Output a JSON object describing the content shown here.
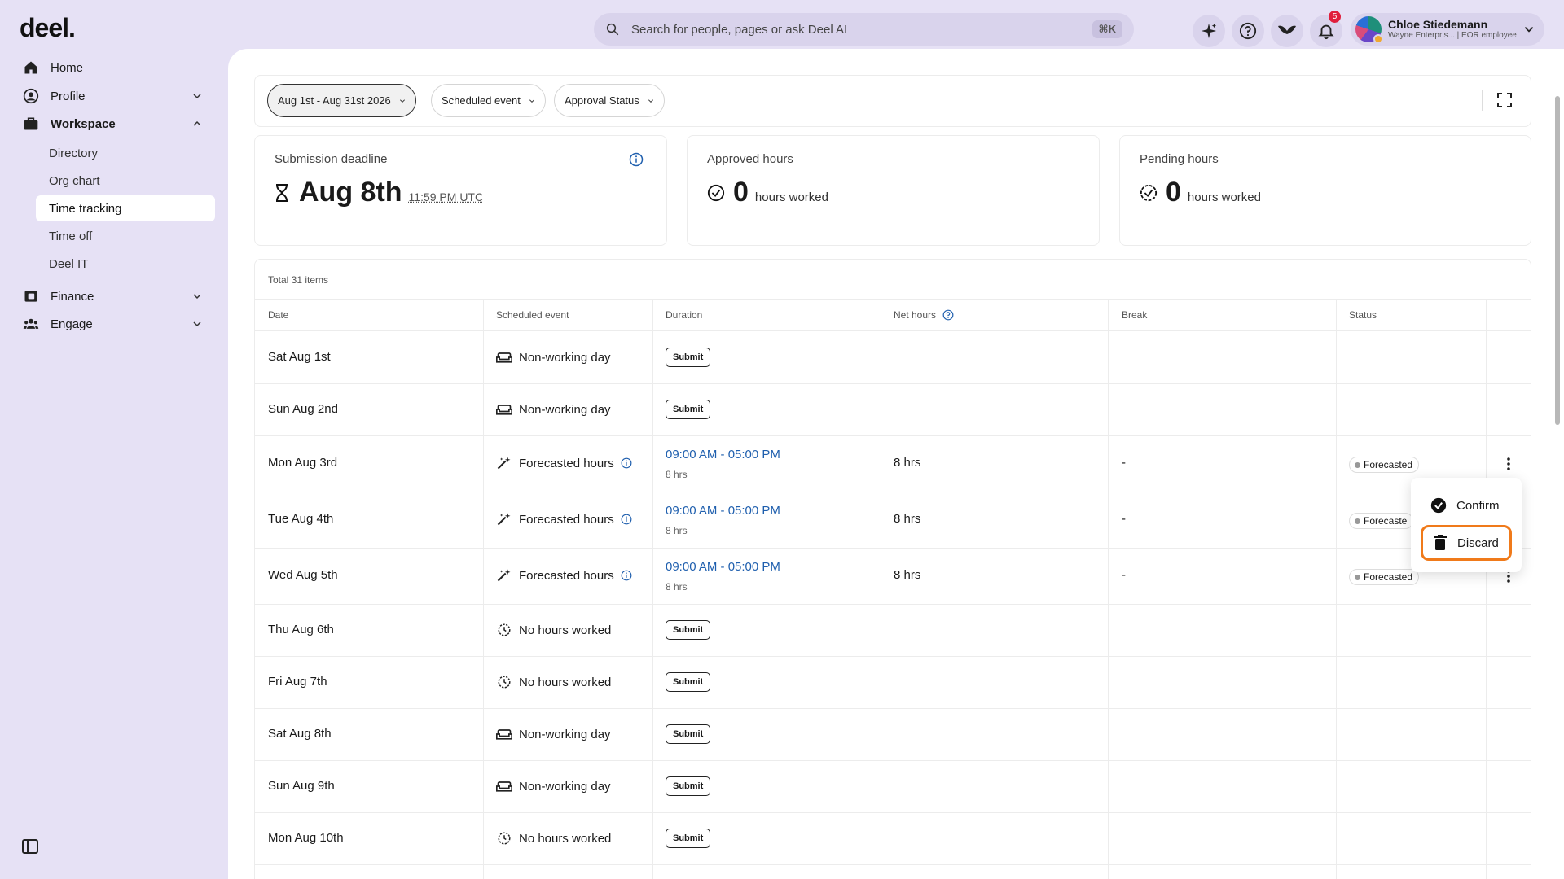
{
  "app": {
    "logo": "deel."
  },
  "topbar": {
    "search_placeholder": "Search for people, pages or ask Deel AI",
    "search_shortcut": "⌘K",
    "notifications_count": "5",
    "user_name": "Chloe Stiedemann",
    "user_sub": "Wayne Enterpris... | EOR employee"
  },
  "sidebar": {
    "home": "Home",
    "profile": "Profile",
    "workspace": "Workspace",
    "workspace_items": [
      "Directory",
      "Org chart",
      "Time tracking",
      "Time off",
      "Deel IT"
    ],
    "finance": "Finance",
    "engage": "Engage"
  },
  "filters": {
    "date_range": "Aug 1st - Aug 31st 2026",
    "scheduled_event": "Scheduled event",
    "approval_status": "Approval Status"
  },
  "cards": {
    "deadline_label": "Submission deadline",
    "deadline_date": "Aug 8th",
    "deadline_time": "11:59 PM UTC",
    "approved_label": "Approved hours",
    "approved_value": "0",
    "approved_unit": "hours worked",
    "pending_label": "Pending hours",
    "pending_value": "0",
    "pending_unit": "hours worked"
  },
  "table": {
    "total": "Total 31 items",
    "headers": {
      "date": "Date",
      "event": "Scheduled event",
      "duration": "Duration",
      "net": "Net hours",
      "break": "Break",
      "status": "Status"
    },
    "submit_label": "Submit",
    "rows": [
      {
        "date": "Sat Aug 1st",
        "event": "Non-working day"
      },
      {
        "date": "Sun Aug 2nd",
        "event": "Non-working day"
      },
      {
        "date": "Mon Aug 3rd",
        "event": "Forecasted hours",
        "time": "09:00 AM - 05:00 PM",
        "hrs": "8 hrs",
        "net": "8 hrs",
        "break": "-",
        "status": "Forecasted"
      },
      {
        "date": "Tue Aug 4th",
        "event": "Forecasted hours",
        "time": "09:00 AM - 05:00 PM",
        "hrs": "8 hrs",
        "net": "8 hrs",
        "break": "-",
        "status": "Forecaste"
      },
      {
        "date": "Wed Aug 5th",
        "event": "Forecasted hours",
        "time": "09:00 AM - 05:00 PM",
        "hrs": "8 hrs",
        "net": "8 hrs",
        "break": "-",
        "status": "Forecasted"
      },
      {
        "date": "Thu Aug 6th",
        "event": "No hours worked"
      },
      {
        "date": "Fri Aug 7th",
        "event": "No hours worked"
      },
      {
        "date": "Sat Aug 8th",
        "event": "Non-working day"
      },
      {
        "date": "Sun Aug 9th",
        "event": "Non-working day"
      },
      {
        "date": "Mon Aug 10th",
        "event": "No hours worked"
      }
    ]
  },
  "menu": {
    "confirm": "Confirm",
    "discard": "Discard"
  }
}
